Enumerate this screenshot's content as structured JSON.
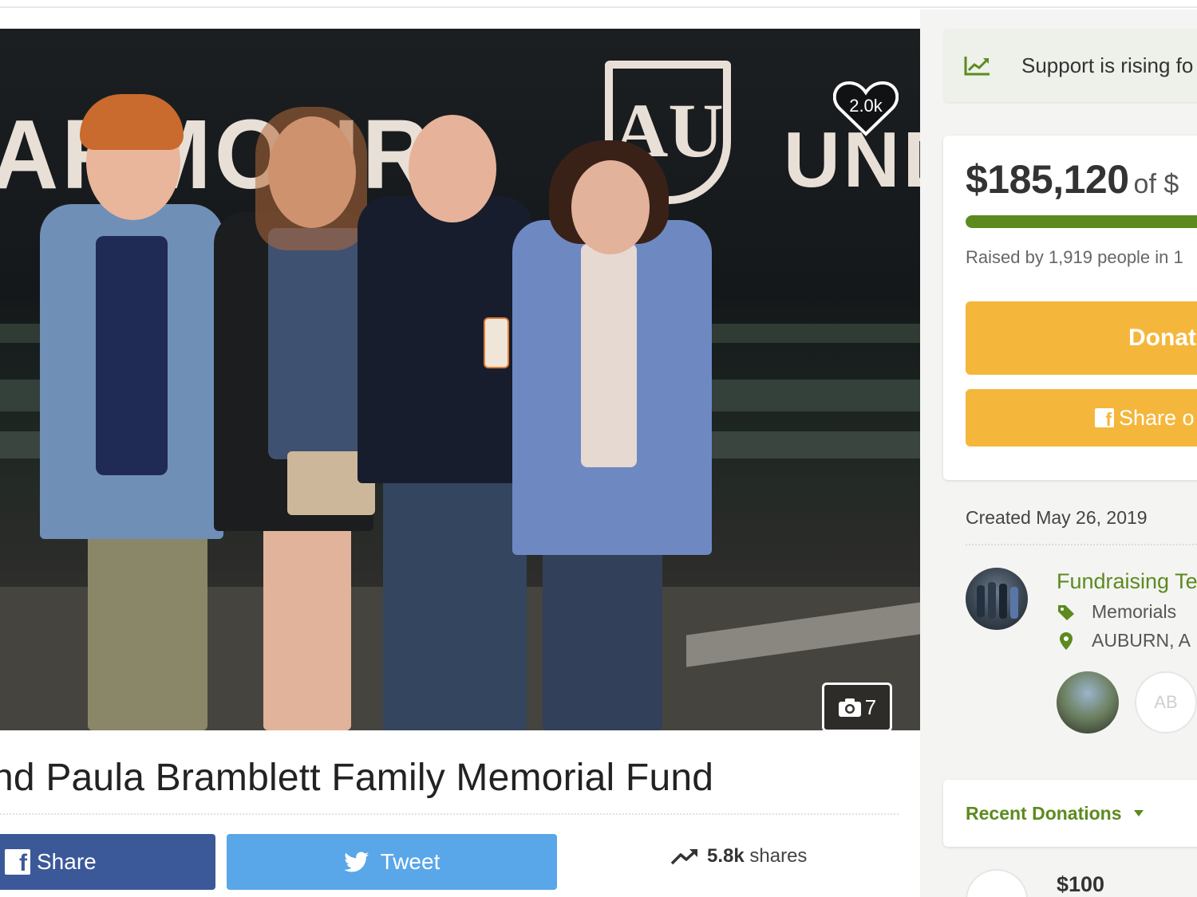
{
  "hero": {
    "wall_text_left": "ARMOUR",
    "wall_text_right": "UND",
    "logo_text": "AU",
    "likes": "2.0k",
    "photo_count": "7",
    "heart_icon": "heart-icon",
    "camera_icon": "camera-icon"
  },
  "campaign": {
    "title": "nd Paula Bramblett Family Memorial Fund",
    "share_label": "Share",
    "tweet_label": "Tweet",
    "shares_count": "5.8k",
    "shares_suffix": "shares"
  },
  "sidebar": {
    "rising_text": "Support is rising fo",
    "amount_raised": "$185,120",
    "amount_of": "of $",
    "progress_fraction": 0.95,
    "raised_text": "Raised by 1,919 people in 1",
    "donate_label": "Donat",
    "share_fb_label": "Share o",
    "created_text": "Created May 26, 2019",
    "team_title": "Fundraising Te",
    "category": "Memorials",
    "location": "AUBURN, A",
    "team_initials": "AB",
    "recent_donations_label": "Recent Donations",
    "first_donation": "$100"
  },
  "colors": {
    "accent_green": "#5c8a1f",
    "donate_yellow": "#f4b73b",
    "facebook_blue": "#3b5998",
    "twitter_blue": "#59a6e9"
  }
}
